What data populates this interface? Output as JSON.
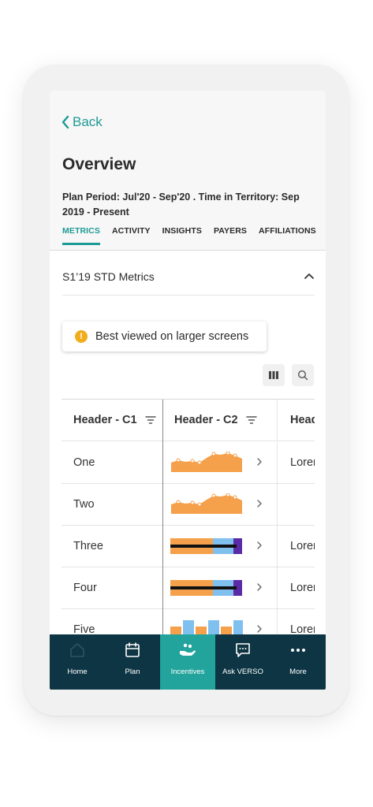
{
  "header": {
    "back_label": "Back",
    "title": "Overview",
    "plan_period": "Plan Period: Jul'20 - Sep'20 . Time in Territory: Sep 2019 - Present"
  },
  "tabs": [
    {
      "label": "METRICS",
      "active": true
    },
    {
      "label": "ACTIVITY",
      "active": false
    },
    {
      "label": "INSIGHTS",
      "active": false
    },
    {
      "label": "PAYERS",
      "active": false
    },
    {
      "label": "AFFILIATIONS",
      "active": false
    }
  ],
  "section": {
    "title": "S1’19 STD Metrics"
  },
  "notice": {
    "text": "Best viewed on larger screens",
    "icon": "warning-icon"
  },
  "table": {
    "headers": [
      "Header - C1",
      "Header - C2",
      "Head"
    ],
    "rows": [
      {
        "c1": "One",
        "chart": "area",
        "c3": "Lorem"
      },
      {
        "c1": "Two",
        "chart": "area",
        "c3": ""
      },
      {
        "c1": "Three",
        "chart": "bullet",
        "c3": "Lorem"
      },
      {
        "c1": "Four",
        "chart": "bullet",
        "c3": "Lorem"
      },
      {
        "c1": "Five",
        "chart": "bars",
        "c3": "Lorem"
      }
    ]
  },
  "colors": {
    "accent": "#1c9a94",
    "nav_bg": "#0d3544",
    "nav_active": "#22a39c",
    "chart_orange": "#f5a04a",
    "chart_blue": "#7fc0ef",
    "chart_purple": "#5b2aa6"
  },
  "bottom_nav": [
    {
      "label": "Home",
      "icon": "home-icon",
      "active": false
    },
    {
      "label": "Plan",
      "icon": "calendar-icon",
      "active": false
    },
    {
      "label": "Incentives",
      "icon": "incentives-icon",
      "active": true
    },
    {
      "label": "Ask VERSO",
      "icon": "chat-icon",
      "active": false
    },
    {
      "label": "More",
      "icon": "more-icon",
      "active": false
    }
  ]
}
